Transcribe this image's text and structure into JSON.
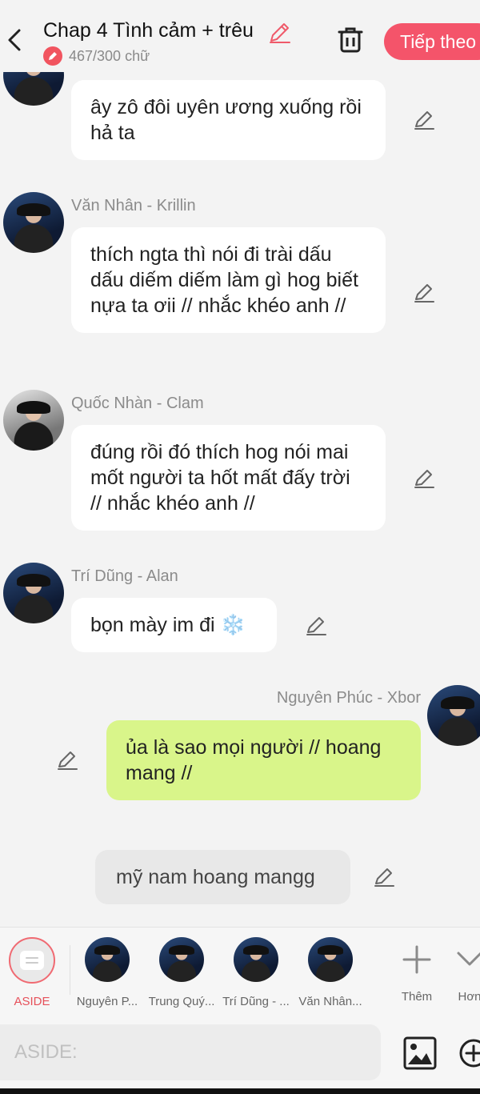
{
  "header": {
    "title": "Chap 4 Tình cảm + trêu",
    "word_count": "467/300 chữ",
    "next_label": "Tiếp theo"
  },
  "messages": [
    {
      "sender": "",
      "text": "ây zô đôi uyên ương xuống rồi hả ta"
    },
    {
      "sender": "Văn Nhân - Krillin",
      "text": "thích ngta thì nói đi trài dấu dấu diếm diếm làm gì hog biết nựa ta ơii // nhắc khéo anh //"
    },
    {
      "sender": "Quốc Nhàn - Clam",
      "text": "đúng rồi đó thích hog nói mai mốt người ta hốt mất đấy trời // nhắc khéo anh //"
    },
    {
      "sender": "Trí Dũng - Alan",
      "text": "bọn mày im đi ❄️"
    },
    {
      "sender": "Nguyên Phúc - Xbor",
      "text": "ủa là sao mọi người // hoang mang //"
    },
    {
      "sender": "",
      "text": "mỹ nam hoang mangg"
    }
  ],
  "characters": [
    {
      "name": "ASIDE",
      "selected": true
    },
    {
      "name": "Nguyên P..."
    },
    {
      "name": "Trung Quý..."
    },
    {
      "name": "Trí Dũng - ..."
    },
    {
      "name": "Văn Nhân..."
    },
    {
      "name": "Thêm"
    },
    {
      "name": "Hơn"
    }
  ],
  "input": {
    "placeholder": "ASIDE:"
  },
  "colors": {
    "accent": "#f4546a",
    "mine_bubble": "#d9f58a",
    "aside_bubble": "#e8e8e8"
  },
  "icons": [
    "back-icon",
    "edit-icon",
    "trash-icon",
    "pencil-icon",
    "aside-icon",
    "plus-icon",
    "chevron-down-icon",
    "image-icon",
    "add-circle-icon"
  ]
}
